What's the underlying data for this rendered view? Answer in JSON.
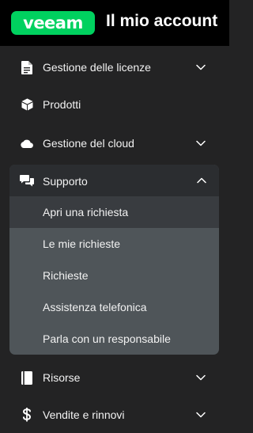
{
  "header": {
    "logo_text": "veeam",
    "title": "Il mio account"
  },
  "colors": {
    "brand_green": "#00d15f",
    "header_bg": "#000000",
    "sidebar_bg": "#232324",
    "submenu_bg": "#4f5559",
    "active_item_bg": "#393c40"
  },
  "nav": {
    "licenses": {
      "label": "Gestione delle licenze",
      "icon": "document-icon",
      "expanded": false
    },
    "products": {
      "label": "Prodotti",
      "icon": "cube-icon"
    },
    "cloud": {
      "label": "Gestione del cloud",
      "icon": "cloud-icon",
      "expanded": false
    },
    "support": {
      "label": "Supporto",
      "icon": "chat-bubbles-icon",
      "expanded": true,
      "items": [
        {
          "label": "Apri una richiesta",
          "active": true
        },
        {
          "label": "Le mie richieste"
        },
        {
          "label": "Richieste"
        },
        {
          "label": "Assistenza telefonica"
        },
        {
          "label": "Parla con un responsabile"
        }
      ]
    },
    "resources": {
      "label": "Risorse",
      "icon": "book-icon",
      "expanded": false
    },
    "sales": {
      "label": "Vendite e rinnovi",
      "icon": "dollar-icon",
      "expanded": false
    }
  }
}
